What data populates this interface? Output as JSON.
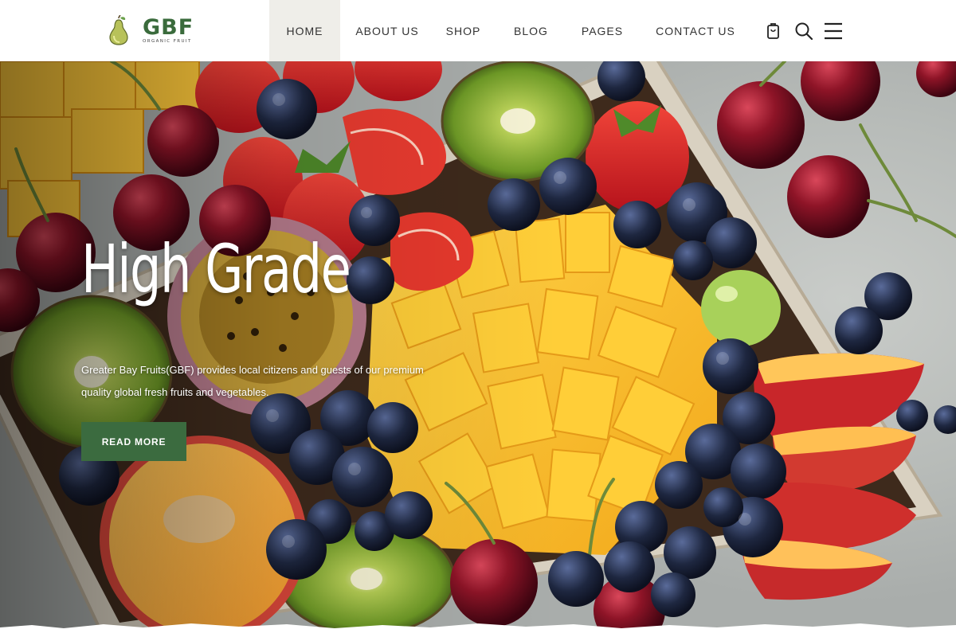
{
  "brand": {
    "name": "GBF",
    "tagline": "ORGANIC FRUIT",
    "icon": "pear-icon",
    "color": "#3a6b3c"
  },
  "nav": {
    "items": [
      {
        "label": "HOME",
        "active": true
      },
      {
        "label": "ABOUT US",
        "active": false
      },
      {
        "label": "SHOP",
        "active": false
      },
      {
        "label": "BLOG",
        "active": false
      },
      {
        "label": "PAGES",
        "active": false
      },
      {
        "label": "CONTACT US",
        "active": false
      }
    ],
    "icons": [
      "shopping-bag-icon",
      "search-icon",
      "hamburger-menu-icon"
    ]
  },
  "hero": {
    "title": "High Grade",
    "description": "Greater Bay Fruits(GBF) provides local citizens and guests of our premium quality global fresh fruits and vegetables.",
    "button_label": "READ MORE",
    "button_color": "#3b6b3f",
    "image": "fruit-platter-image"
  }
}
